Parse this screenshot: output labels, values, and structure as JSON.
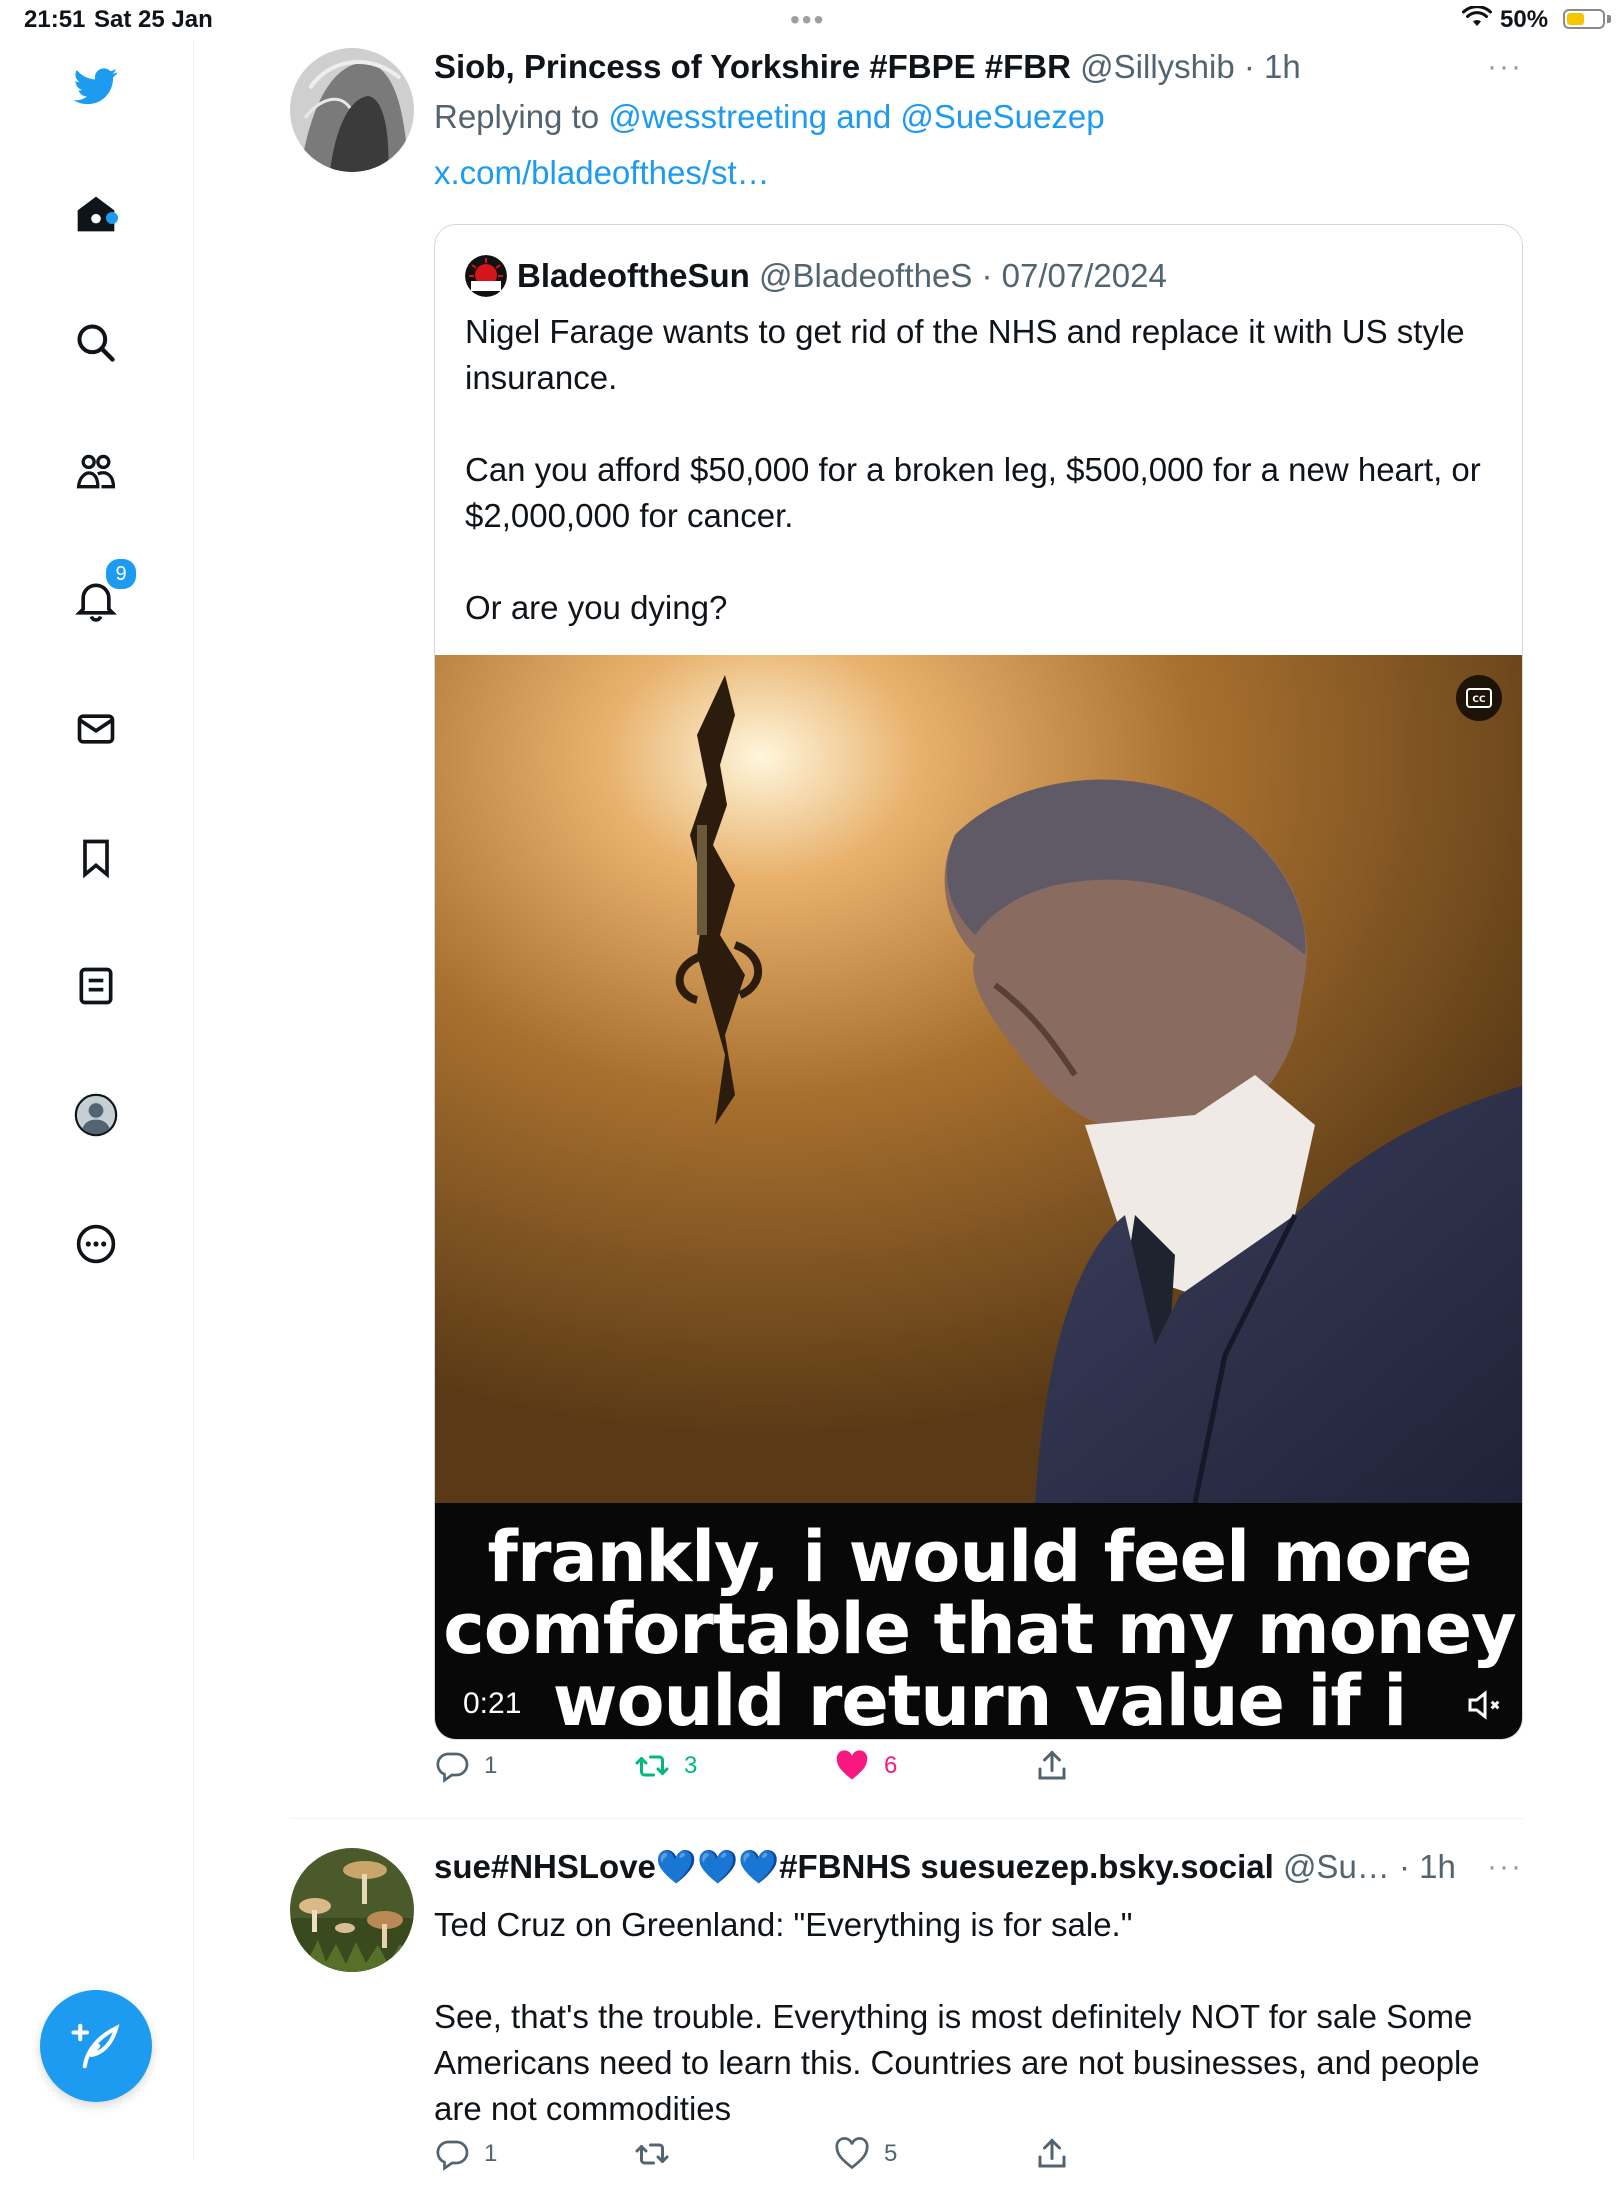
{
  "status_bar": {
    "time": "21:51",
    "date": "Sat 25 Jan",
    "battery_pct": "50%",
    "battery_level": 0.5
  },
  "sidebar": {
    "items": [
      {
        "name": "twitter-logo",
        "icon": "bird-icon"
      },
      {
        "name": "home",
        "icon": "home-icon",
        "has_dot": true
      },
      {
        "name": "search",
        "icon": "search-icon"
      },
      {
        "name": "communities",
        "icon": "people-icon"
      },
      {
        "name": "notifications",
        "icon": "bell-icon",
        "badge": "9"
      },
      {
        "name": "messages",
        "icon": "mail-icon"
      },
      {
        "name": "bookmarks",
        "icon": "bookmark-icon"
      },
      {
        "name": "lists",
        "icon": "list-icon"
      },
      {
        "name": "profile",
        "icon": "avatar-icon"
      },
      {
        "name": "more",
        "icon": "more-circle-icon"
      }
    ],
    "notifications_badge": "9",
    "compose_icon": "compose-feather-icon"
  },
  "tweet1": {
    "name": "Siob, Princess of Yorkshire #FBPE #FBR",
    "handle_time": "@Sillyshib · 1h",
    "more": "···",
    "replying_prefix": "Replying to ",
    "replying_to": "@wesstreeting and @SueSuezep",
    "link": "x.com/bladeofthes/st…",
    "quote": {
      "name": "BladeoftheSun",
      "handle_date": "@BladeoftheS · 07/07/2024",
      "paragraphs": [
        "Nigel Farage wants to get rid of the NHS and replace it with US style insurance.",
        "Can you afford $50,000 for a broken leg, $500,000 for a new heart, or $2,000,000 for cancer.",
        "Or are you dying?"
      ],
      "video": {
        "caption": "frankly, i would feel more comfortable that my money would return value if i",
        "duration": "0:21",
        "cc_icon": "closed-captions-icon",
        "mute_icon": "muted-speaker-icon"
      }
    },
    "actions": {
      "replies": "1",
      "retweets": "3",
      "likes": "6"
    }
  },
  "tweet2": {
    "name": "sue#NHSLove💙💙💙#FBNHS suesuezep.bsky.social",
    "handle_time": "@Su… · 1h",
    "more": "···",
    "paragraphs": [
      "Ted Cruz on Greenland: \"Everything is for sale.\"",
      "See, that's the trouble. Everything is most definitely NOT for sale Some Americans need to learn this. Countries are not businesses, and people are not commodities"
    ],
    "actions": {
      "replies": "1",
      "retweets": "",
      "likes": "5"
    }
  },
  "colors": {
    "accent": "#1d9bf0",
    "retweet": "#00ba7c",
    "like": "#f91880",
    "muted_text": "#536471"
  }
}
